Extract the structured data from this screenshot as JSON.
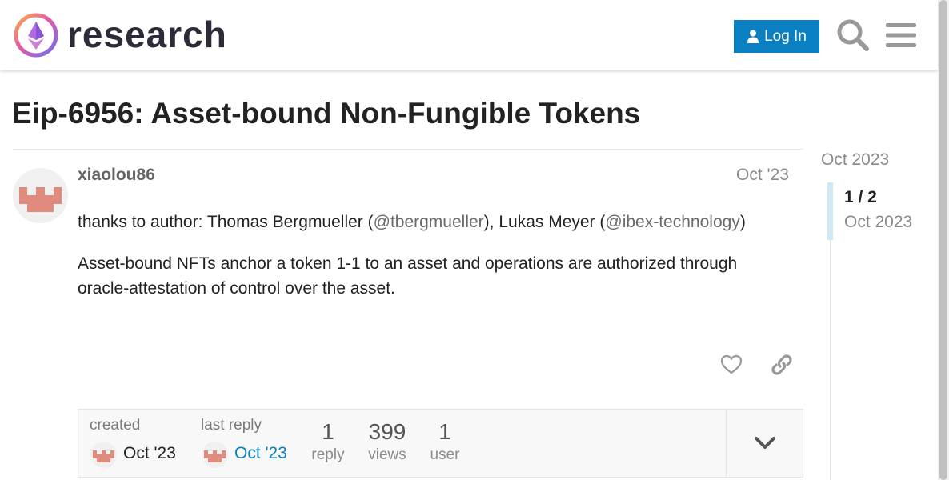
{
  "header": {
    "site_name": "research",
    "login_label": "Log In"
  },
  "topic": {
    "title": "Eip-6956: Asset-bound Non-Fungible Tokens"
  },
  "post": {
    "author": "xiaolou86",
    "date": "Oct '23",
    "p1_prefix": "thanks to author: Thomas Bergmueller (",
    "p1_mention1": "@tbergmueller",
    "p1_middle": "), Lukas Meyer (",
    "p1_mention2": "@ibex-technology",
    "p1_suffix": ")",
    "p2": "Asset-bound NFTs anchor a token 1-1 to an asset and operations are authorized through oracle-attestation of control over the asset."
  },
  "topic_map": {
    "created_label": "created",
    "created_date": "Oct '23",
    "last_reply_label": "last reply",
    "last_reply_date": "Oct '23",
    "replies_count": "1",
    "replies_label": "reply",
    "views_count": "399",
    "views_label": "views",
    "users_count": "1",
    "users_label": "user"
  },
  "timeline": {
    "top_date": "Oct 2023",
    "position": "1 / 2",
    "position_date": "Oct 2023"
  },
  "colors": {
    "accent": "#0a7fc2",
    "avatar": "#e08b7d"
  },
  "icons": [
    "logo-icon",
    "user-icon",
    "search-icon",
    "menu-icon",
    "heart-icon",
    "link-icon",
    "chevron-down-icon"
  ]
}
